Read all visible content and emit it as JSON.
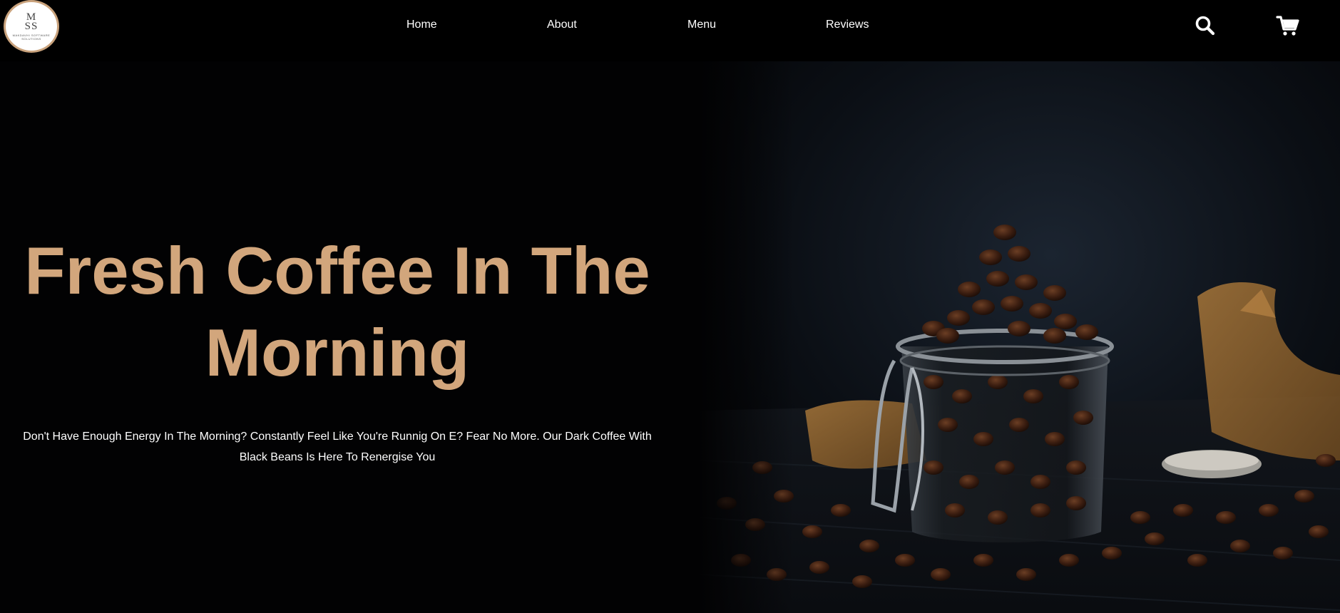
{
  "header": {
    "logo": {
      "initials_top": "M",
      "initials_bottom": "SS",
      "company": "MAKDAVHI SOFTWARE SOLUTIONS"
    },
    "nav": [
      {
        "label": "Home"
      },
      {
        "label": "About"
      },
      {
        "label": "Menu"
      },
      {
        "label": "Reviews"
      }
    ],
    "icons": {
      "search": "search-icon",
      "cart": "cart-icon"
    }
  },
  "hero": {
    "title": "Fresh Coffee In The Morning",
    "subtitle": "Don't Have Enough Energy In The Morning? Constantly Feel Like You're Runnig On E? Fear No More. Our Dark Coffee With Black Beans Is Here To Renergise You",
    "image_subject": "coffee-beans-jar-image"
  },
  "colors": {
    "background": "#020203",
    "accent": "#d2a67c",
    "text": "#ffffff",
    "logo_ring": "#c9a27c"
  }
}
